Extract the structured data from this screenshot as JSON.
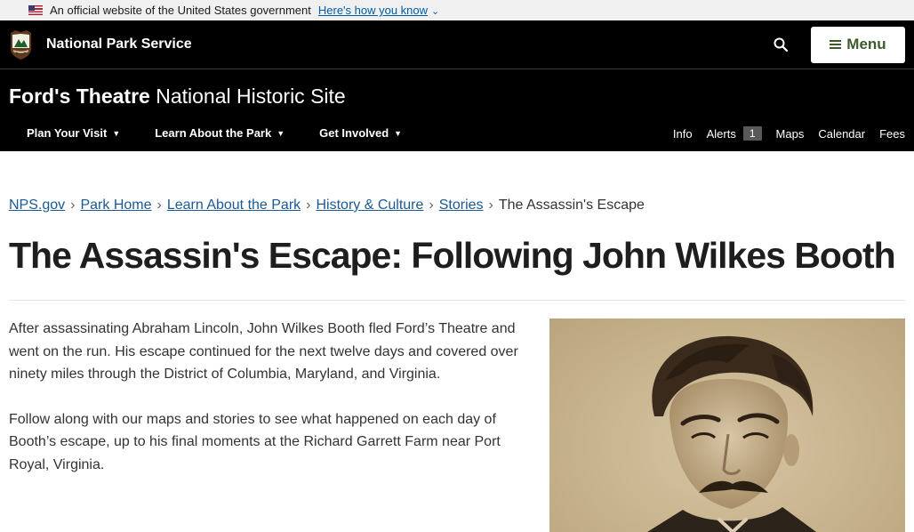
{
  "gov_banner": {
    "text": "An official website of the United States government",
    "link": "Here's how you know"
  },
  "nps_header": {
    "brand": "National Park Service",
    "menu_label": "Menu"
  },
  "park": {
    "name": "Ford's Theatre",
    "designation": "National Historic Site"
  },
  "park_nav": {
    "left": [
      {
        "label": "Plan Your Visit"
      },
      {
        "label": "Learn About the Park"
      },
      {
        "label": "Get Involved"
      }
    ],
    "right": {
      "info": "Info",
      "alerts": "Alerts",
      "alerts_count": "1",
      "maps": "Maps",
      "calendar": "Calendar",
      "fees": "Fees"
    }
  },
  "breadcrumb": {
    "items": [
      "NPS.gov",
      "Park Home",
      "Learn About the Park",
      "History & Culture",
      "Stories"
    ],
    "current": "The Assassin's Escape"
  },
  "page_title": "The Assassin's Escape: Following John Wilkes Booth",
  "body": {
    "paragraphs": [
      "After assassinating Abraham Lincoln, John Wilkes Booth fled Ford’s Theatre and went on the run. His escape continued for the next twelve days and covered over ninety miles through the District of Columbia, Maryland, and Virginia.",
      "Follow along with our maps and stories to see what happened on each day of Booth’s escape, up to his final moments at the Richard Garrett Farm near Port Royal, Virginia."
    ]
  },
  "icons": {
    "logo": "nps-arrowhead-icon",
    "search": "search-icon",
    "menu": "hamburger-icon"
  }
}
